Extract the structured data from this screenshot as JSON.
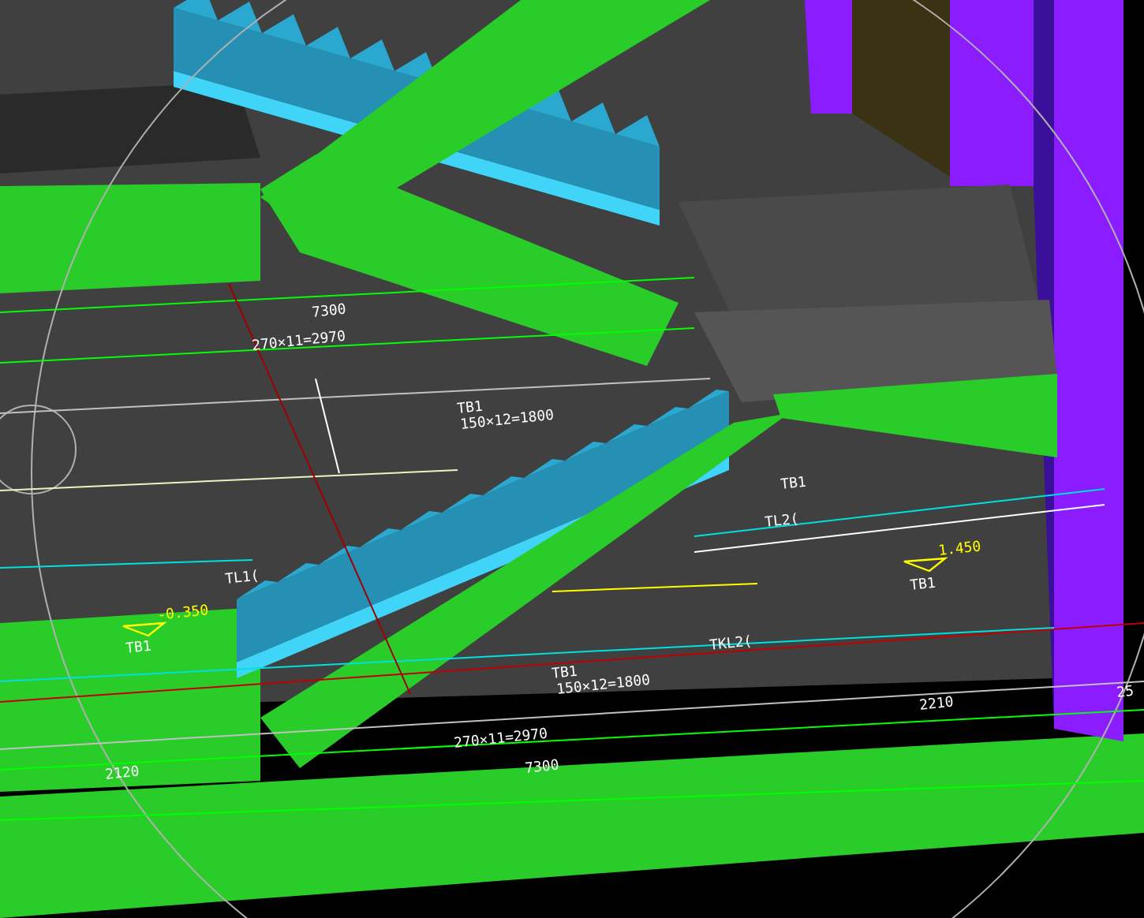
{
  "viewport": {
    "annotations": [
      {
        "text": "7300",
        "kind": "dimension"
      },
      {
        "text": "270×11=2970",
        "kind": "dimension"
      },
      {
        "text": "TB1",
        "kind": "tag"
      },
      {
        "text": "150×12=1800",
        "kind": "tag"
      },
      {
        "text": "TB1",
        "kind": "tag"
      },
      {
        "text": "TL2(",
        "kind": "tag"
      },
      {
        "text": "1.450",
        "kind": "elevation"
      },
      {
        "text": "TB1",
        "kind": "tag"
      },
      {
        "text": "TL1(",
        "kind": "tag"
      },
      {
        "text": "-0.350",
        "kind": "elevation"
      },
      {
        "text": "TB1",
        "kind": "tag"
      },
      {
        "text": "TKL2(",
        "kind": "tag"
      },
      {
        "text": "TB1",
        "kind": "tag"
      },
      {
        "text": "150×12=1800",
        "kind": "tag"
      },
      {
        "text": "2210",
        "kind": "dimension"
      },
      {
        "text": "270×11=2970",
        "kind": "dimension"
      },
      {
        "text": "7300",
        "kind": "dimension"
      },
      {
        "text": "2120",
        "kind": "dimension"
      },
      {
        "text": "25",
        "kind": "dimension"
      }
    ]
  }
}
